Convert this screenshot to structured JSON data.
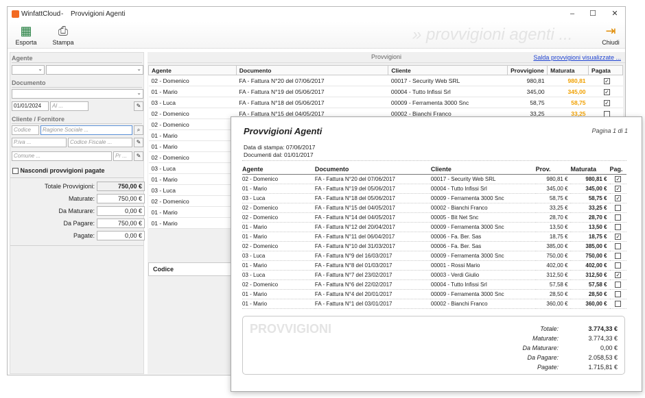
{
  "window": {
    "app": "WinfattCloud",
    "separator": "-",
    "page": "Provvigioni Agenti",
    "min": "–",
    "max": "☐",
    "close": "✕"
  },
  "toolbar": {
    "export": "Esporta",
    "print": "Stampa",
    "close": "Chiudi",
    "watermark": "» provvigioni agenti ..."
  },
  "filters": {
    "agent_label": "Agente",
    "document_label": "Documento",
    "date_from": "01/01/2024",
    "date_to_placeholder": "Al ...",
    "customer_label": "Cliente / Fornitore",
    "code_placeholder": "Codice",
    "company_placeholder": "Ragione Sociale ...",
    "vat_placeholder": "P.iva ...",
    "taxcode_placeholder": "Codice Fiscale ...",
    "city_placeholder": "Comune ...",
    "prov_placeholder": "Pr ...",
    "hide_paid_label": "Nascondi provvigioni pagate"
  },
  "summary": [
    {
      "label": "Totale Provvigioni:",
      "value": "750,00 €"
    },
    {
      "label": "Maturate:",
      "value": "750,00 €"
    },
    {
      "label": "Da Maturare:",
      "value": "0,00 €"
    },
    {
      "label": "Da Pagare:",
      "value": "750,00 €"
    },
    {
      "label": "Pagate:",
      "value": "0,00 €"
    }
  ],
  "grid": {
    "title": "Provvigioni",
    "link": "Salda provvigioni visualizzate ...",
    "headers": [
      "Agente",
      "Documento",
      "Cliente",
      "Provvigione",
      "Maturata",
      "Pagata"
    ],
    "rows": [
      [
        "02 - Domenico",
        "FA - Fattura N°20 del 07/06/2017",
        "00017 - Security Web SRL",
        "980,81",
        "980,81",
        "✓"
      ],
      [
        "01 - Mario",
        "FA - Fattura N°19 del 05/06/2017",
        "00004 - Tutto Infissi Srl",
        "345,00",
        "345,00",
        "✓"
      ],
      [
        "03 - Luca",
        "FA - Fattura N°18 del 05/06/2017",
        "00009 - Ferramenta 3000 Snc",
        "58,75",
        "58,75",
        "✓"
      ],
      [
        "02 - Domenico",
        "FA - Fattura N°15 del 04/05/2017",
        "00002 - Bianchi Franco",
        "33,25",
        "33,25",
        ""
      ]
    ],
    "agent_only_rows": [
      "02 - Domenico",
      "01 - Mario",
      "01 - Mario",
      "02 - Domenico",
      "03 - Luca",
      "01 - Mario",
      "03 - Luca",
      "02 - Domenico",
      "01 - Mario",
      "01 - Mario"
    ],
    "lower_header": "Codice"
  },
  "report": {
    "title": "Provvigioni Agenti",
    "page": "Pagina 1 di 1",
    "print_date": "Data di stampa: 07/06/2017",
    "docs_from": "Documenti dal: 01/01/2017",
    "headers": [
      "Agente",
      "Documento",
      "Cliente",
      "Prov.",
      "Maturata",
      "Pag."
    ],
    "rows": [
      [
        "02 - Domenico",
        "FA - Fattura N°20 del 07/06/2017",
        "00017 - Security Web SRL",
        "980,81 €",
        "980,81 €",
        "✓"
      ],
      [
        "01 - Mario",
        "FA - Fattura N°19 del 05/06/2017",
        "00004 - Tutto Infissi Srl",
        "345,00 €",
        "345,00 €",
        "✓"
      ],
      [
        "03 - Luca",
        "FA - Fattura N°18 del 05/06/2017",
        "00009 - Ferramenta 3000 Snc",
        "58,75 €",
        "58,75 €",
        "✓"
      ],
      [
        "02 - Domenico",
        "FA - Fattura N°15 del 04/05/2017",
        "00002 - Bianchi Franco",
        "33,25 €",
        "33,25 €",
        ""
      ],
      [
        "02 - Domenico",
        "FA - Fattura N°14 del 04/05/2017",
        "00005 - Bit Net Snc",
        "28,70 €",
        "28,70 €",
        ""
      ],
      [
        "01 - Mario",
        "FA - Fattura N°12 del 20/04/2017",
        "00009 - Ferramenta 3000 Snc",
        "13,50 €",
        "13,50 €",
        ""
      ],
      [
        "01 - Mario",
        "FA - Fattura N°11 del 06/04/2017",
        "00006 - Fa. Ber. Sas",
        "18,75 €",
        "18,75 €",
        "✓"
      ],
      [
        "02 - Domenico",
        "FA - Fattura N°10 del 31/03/2017",
        "00006 - Fa. Ber. Sas",
        "385,00 €",
        "385,00 €",
        ""
      ],
      [
        "03 - Luca",
        "FA - Fattura N°9 del 16/03/2017",
        "00009 - Ferramenta 3000 Snc",
        "750,00 €",
        "750,00 €",
        ""
      ],
      [
        "01 - Mario",
        "FA - Fattura N°8 del 01/03/2017",
        "00001 - Rossi Mario",
        "402,00 €",
        "402,00 €",
        ""
      ],
      [
        "03 - Luca",
        "FA - Fattura N°7 del 23/02/2017",
        "00003 - Verdi Giulio",
        "312,50 €",
        "312,50 €",
        "✓"
      ],
      [
        "02 - Domenico",
        "FA - Fattura N°6 del 22/02/2017",
        "00004 - Tutto Infissi Srl",
        "57,58 €",
        "57,58 €",
        ""
      ],
      [
        "01 - Mario",
        "FA - Fattura N°4 del 20/01/2017",
        "00009 - Ferramenta 3000 Snc",
        "28,50 €",
        "28,50 €",
        ""
      ],
      [
        "01 - Mario",
        "FA - Fattura N°1 del 03/01/2017",
        "00002 - Bianchi Franco",
        "360,00 €",
        "360,00 €",
        ""
      ]
    ],
    "totals_watermark": "PROVVIGIONI",
    "totals": [
      {
        "label": "Totale:",
        "value": "3.774,33 €"
      },
      {
        "label": "Maturate:",
        "value": "3.774,33 €"
      },
      {
        "label": "Da Maturare:",
        "value": "0,00 €"
      },
      {
        "label": "Da Pagare:",
        "value": "2.058,53 €"
      },
      {
        "label": "Pagate:",
        "value": "1.715,81 €"
      }
    ]
  }
}
